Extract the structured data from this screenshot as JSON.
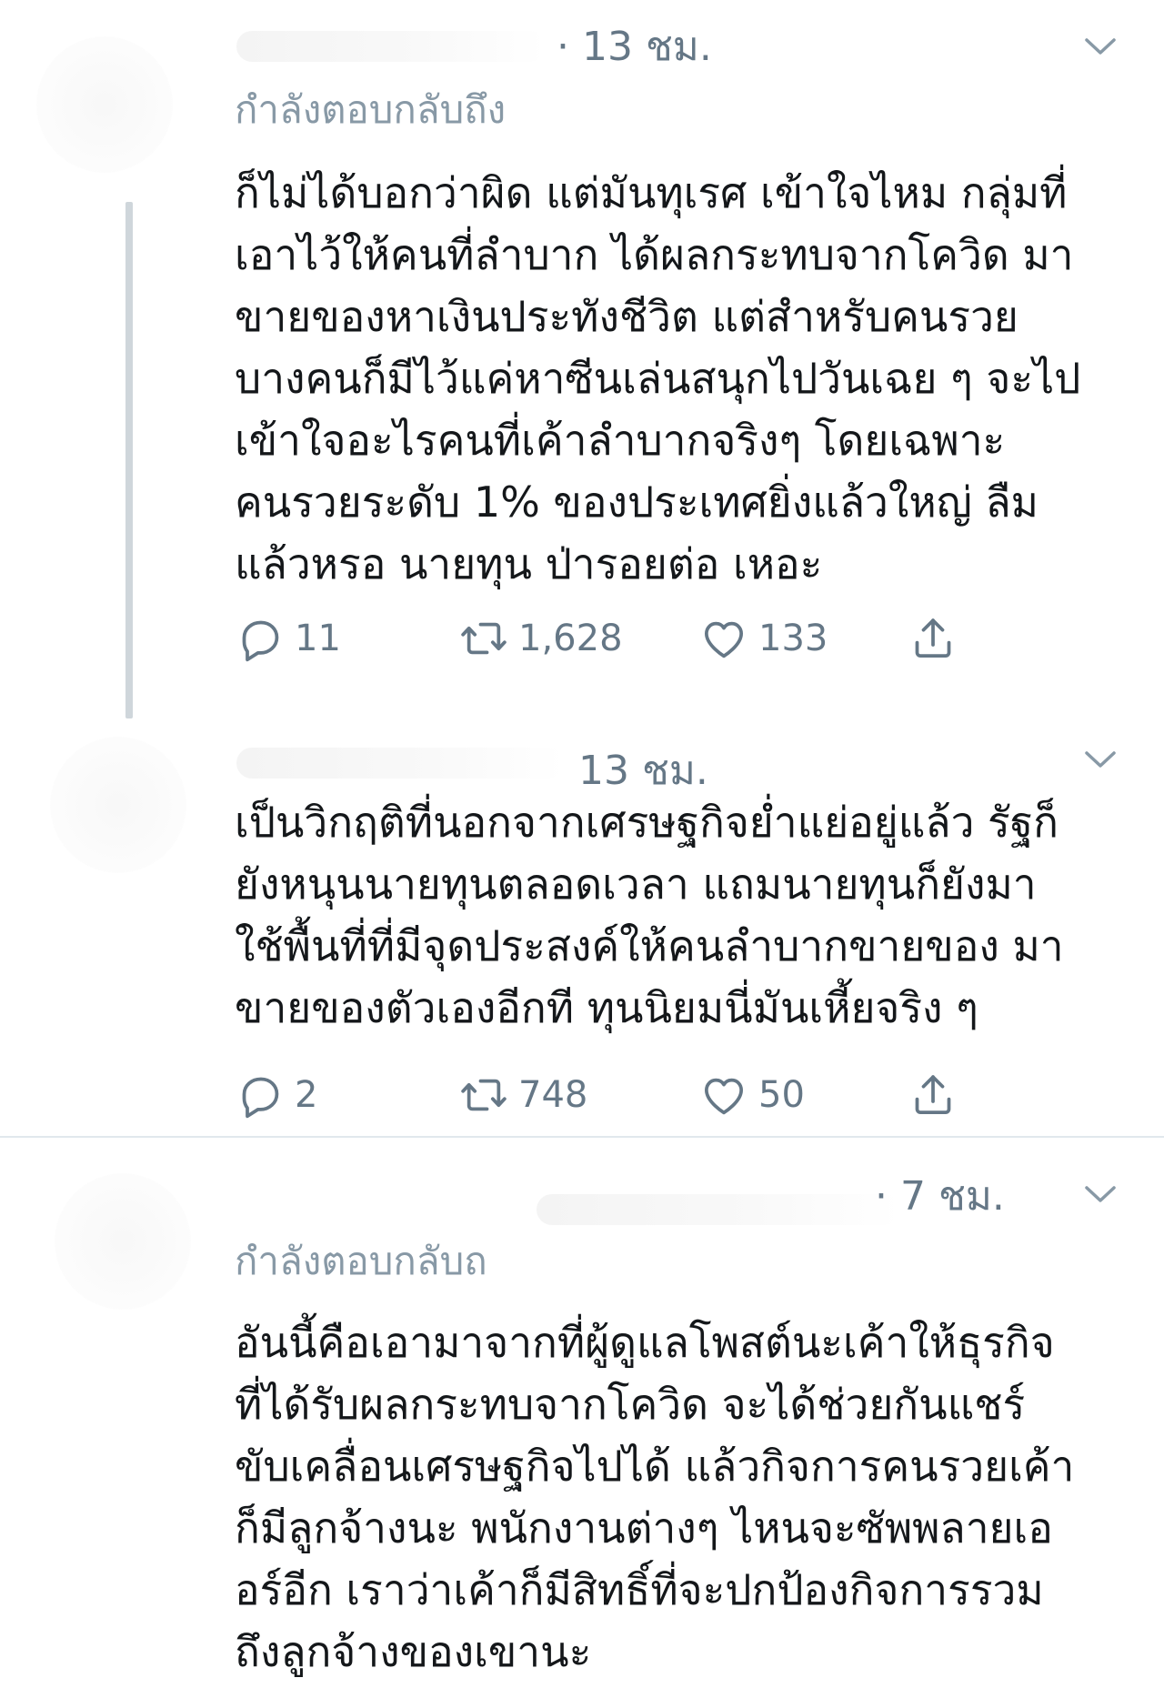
{
  "tweets": [
    {
      "time": "· 13 ชม.",
      "reply_to_label": "กำลังตอบกลับถึง",
      "text_lines": [
        "ก็ไม่ได้บอกว่าผิด แต่มันทุเรศ เข้าใจไหม กลุ่มที่",
        "เอาไว้ให้คนที่ลำบาก ได้ผลกระทบจากโควิด มา",
        "ขายของหาเงินประทังชีวิต แต่สำหรับคนรวย",
        "บางคนก็มีไว้แค่หาซีนเล่นสนุกไปวันเฉย ๆ จะไป",
        "เข้าใจอะไรคนที่เค้าลำบากจริงๆ โดยเฉพาะ",
        "คนรวยระดับ 1% ของประเทศยิ่งแล้วใหญ่ ลืม",
        "แล้วหรอ นายทุน ป่ารอยต่อ เหอะ"
      ],
      "replies": "11",
      "retweets": "1,628",
      "likes": "133"
    },
    {
      "time": "13 ชม.",
      "text_lines": [
        "เป็นวิกฤติที่นอกจากเศรษฐกิจย่ำแย่อยู่แล้ว รัฐก็",
        "ยังหนุนนายทุนตลอดเวลา แถมนายทุนก็ยังมา",
        "ใช้พื้นที่ที่มีจุดประสงค์ให้คนลำบากขายของ มา",
        "ขายของตัวเองอีกที ทุนนิยมนี่มันเหี้ยจริง ๆ"
      ],
      "replies": "2",
      "retweets": "748",
      "likes": "50"
    },
    {
      "time": "· 7 ชม.",
      "reply_to_label": "กำลังตอบกลับถ",
      "text_lines": [
        "อันนี้คือเอามาจากที่ผู้ดูแลโพสต์นะเค้าให้ธุรกิจ",
        "ที่ได้รับผลกระทบจากโควิด จะได้ช่วยกันแชร์",
        "ขับเคลื่อนเศรษฐกิจไปได้ แล้วกิจการคนรวยเค้า",
        "ก็มีลูกจ้างนะ พนักงานต่างๆ ไหนจะซัพพลายเอ",
        "อร์อีก เราว่าเค้าก็มีสิทธิ์ที่จะปกป้องกิจการรวม",
        "ถึงลูกจ้างของเขานะ"
      ]
    }
  ],
  "icons": {
    "reply": "reply-icon",
    "retweet": "retweet-icon",
    "like": "heart-icon",
    "share": "share-icon",
    "caret": "chevron-down-icon"
  },
  "colors": {
    "text": "#14171a",
    "secondary": "#657786",
    "muted": "#8899a6",
    "divider": "#e1e8ed"
  }
}
